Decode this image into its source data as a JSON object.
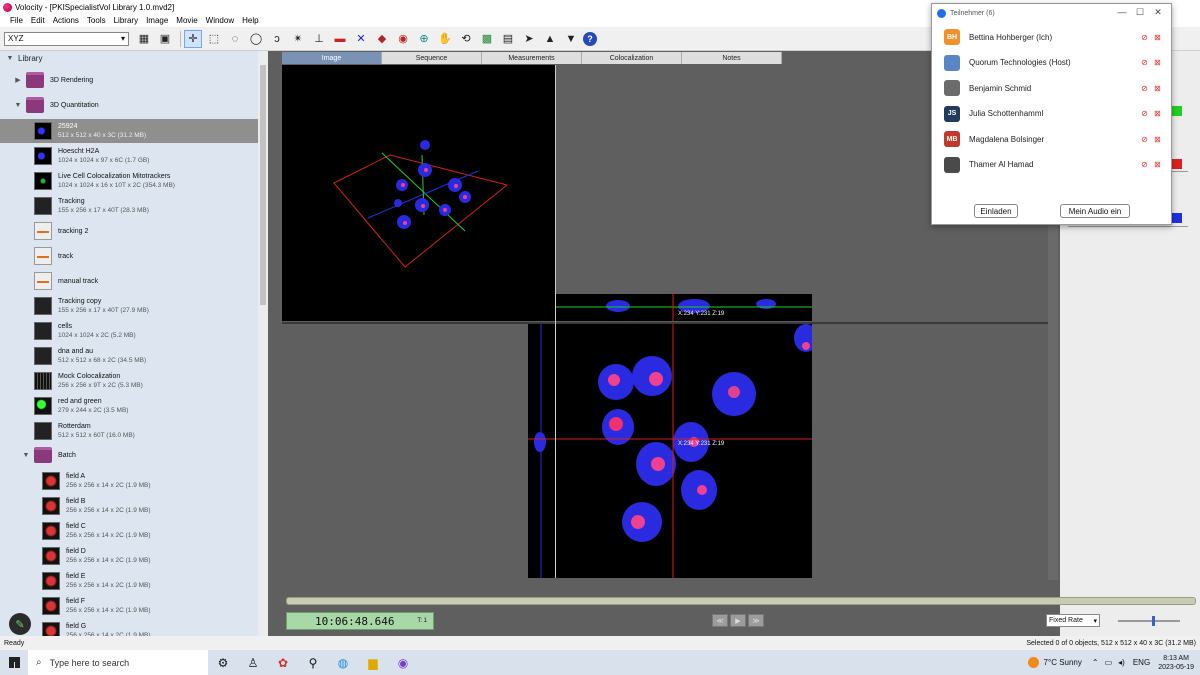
{
  "window": {
    "title": "Volocity - [PKISpecialistVol Library 1.0.mvd2]"
  },
  "menu": [
    "File",
    "Edit",
    "Actions",
    "Tools",
    "Library",
    "Image",
    "Movie",
    "Window",
    "Help"
  ],
  "toolbar": {
    "view_mode": "XYZ",
    "help_label": "?"
  },
  "library": {
    "header": "Library",
    "folders": [
      {
        "name": "3D Rendering"
      },
      {
        "name": "3D Quantitation"
      },
      {
        "name": "Batch"
      }
    ],
    "items": [
      {
        "name": "25924",
        "meta": "512 x 512 x 40 x 3C (31.2 MB)",
        "thumb": "blue",
        "selected": true
      },
      {
        "name": "Hoescht H2A",
        "meta": "1024 x 1024 x 97 x 6C (1.7 GB)",
        "thumb": "blue"
      },
      {
        "name": "Live Cell Colocalization Mitotrackers",
        "meta": "1024 x 1024 x 16 x 10T x 2C (354.3 MB)",
        "thumb": "green"
      },
      {
        "name": "Tracking",
        "meta": "155 x 256 x 17 x 40T (28.3 MB)",
        "thumb": "dark"
      },
      {
        "name": "tracking 2",
        "meta": "",
        "thumb": "track"
      },
      {
        "name": "track",
        "meta": "",
        "thumb": "track"
      },
      {
        "name": "manual track",
        "meta": "",
        "thumb": "track"
      },
      {
        "name": "Tracking copy",
        "meta": "155 x 256 x 17 x 40T (27.9 MB)",
        "thumb": "dark"
      },
      {
        "name": "cells",
        "meta": "1024 x 1024 x 2C (5.2 MB)",
        "thumb": "dark"
      },
      {
        "name": "dna and au",
        "meta": "512 x 512 x 68 x 2C (34.5 MB)",
        "thumb": "dark"
      },
      {
        "name": "Mock Colocalization",
        "meta": "256 x 256 x 9T x 2C (5.3 MB)",
        "thumb": "mock"
      },
      {
        "name": "red and green",
        "meta": "279 x 244 x 2C (3.5 MB)",
        "thumb": "rg"
      },
      {
        "name": "Rotterdam",
        "meta": "512 x 512 x 60T (16.0 MB)",
        "thumb": "dark"
      }
    ],
    "batch_items": [
      {
        "name": "field A",
        "meta": "256 x 256 x 14 x 2C (1.9 MB)"
      },
      {
        "name": "field B",
        "meta": "256 x 256 x 14 x 2C (1.9 MB)"
      },
      {
        "name": "field C",
        "meta": "256 x 256 x 14 x 2C (1.9 MB)"
      },
      {
        "name": "field D",
        "meta": "256 x 256 x 14 x 2C (1.9 MB)"
      },
      {
        "name": "field E",
        "meta": "256 x 256 x 14 x 2C (1.9 MB)"
      },
      {
        "name": "field F",
        "meta": "256 x 256 x 14 x 2C (1.9 MB)"
      },
      {
        "name": "field G",
        "meta": "256 x 256 x 14 x 2C (1.9 MB)"
      }
    ]
  },
  "tabs": [
    "Image",
    "Sequence",
    "Measurements",
    "Colocalization",
    "Notes"
  ],
  "viewer": {
    "coord_top": "X:234 Y:231 Z:19",
    "coord_main": "X:234 Y:231 Z:19"
  },
  "transport": {
    "timecode": "10:06:48.646",
    "frame": "T: 1",
    "rate": "Fixed Rate"
  },
  "status": {
    "left": "Ready",
    "right": "Selected 0 of 0 objects, 512 x 512 x 40 x 3C (31.2 MB)"
  },
  "teams": {
    "title": "Teilnehmer (6)",
    "participants": [
      {
        "initials": "BH",
        "name": "Bettina Hohberger (Ich)",
        "color": "#f0912b"
      },
      {
        "initials": "",
        "name": "Quorum Technologies (Host)",
        "color": "#5b86c4"
      },
      {
        "initials": "",
        "name": "Benjamin Schmid",
        "color": "#6b6b6b"
      },
      {
        "initials": "JS",
        "name": "Julia Schottenhamml",
        "color": "#243a5e"
      },
      {
        "initials": "MB",
        "name": "Magdalena Bolsinger",
        "color": "#c0392b"
      },
      {
        "initials": "",
        "name": "Thamer Al Hamad",
        "color": "#4a4a4a"
      }
    ],
    "invite_label": "Einladen",
    "audio_label": "Mein Audio ein"
  },
  "taskbar": {
    "search_placeholder": "Type here to search",
    "weather": "7°C  Sunny",
    "lang": "ENG",
    "time": "8:13 AM",
    "date": "2023-05-19"
  },
  "colors": {
    "accent": "#7a93b5",
    "timecode_bg": "#a8d8a8",
    "folder": "#8a3a7a"
  }
}
